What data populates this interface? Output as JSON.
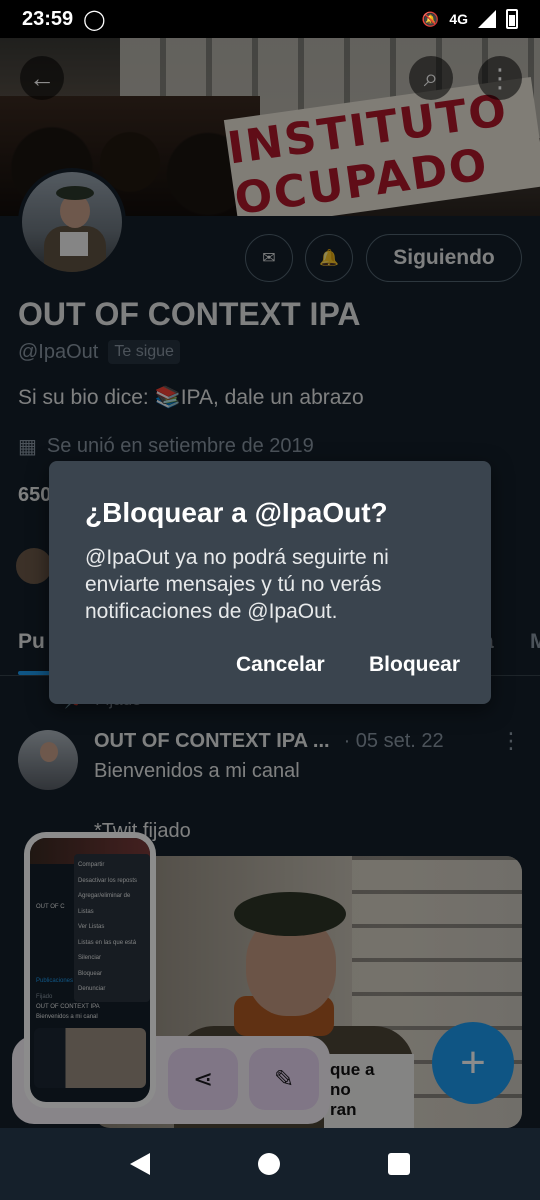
{
  "status_bar": {
    "time": "23:59",
    "network": "4G"
  },
  "banner": {
    "banner_text": "INSTITUTO OCUPADO"
  },
  "profile": {
    "name": "OUT OF CONTEXT IPA",
    "handle": "@IpaOut",
    "follows_you": "Te sigue",
    "bio": "Si su bio dice: 📚IPA, dale un abrazo",
    "joined": "Se unió en setiembre de 2019",
    "stats_prefix": "650",
    "follow_button": "Siguiendo"
  },
  "tabs": [
    {
      "label": "Pu"
    },
    {
      "label": "a"
    },
    {
      "label": "M"
    }
  ],
  "pinned_label": "Fijado",
  "tweet": {
    "name": "OUT OF CONTEXT IPA ...",
    "date": "· 05 set. 22",
    "text": "Bienvenidos a mi canal",
    "text2": "*Twit fijado",
    "image_sign": "que a\nno\nran"
  },
  "dialog": {
    "title": "¿Bloquear a @IpaOut?",
    "body": "@IpaOut ya no podrá seguirte ni enviarte mensajes y tú no verás notificaciones de @IpaOut.",
    "cancel": "Cancelar",
    "confirm": "Bloquear"
  },
  "screenshot_preview": {
    "menu_items": [
      "Compartir",
      "Desactivar los reposts",
      "Agregar/eliminar de Listas",
      "Ver Listas",
      "Listas en las que está",
      "Silenciar",
      "Bloquear",
      "Denunciar"
    ],
    "mini_name": "OUT OF C",
    "mini_tab": "Publicaciones",
    "mini_pinned": "Fijado",
    "mini_tweet": "OUT OF CONTEXT IPA",
    "mini_tweet_text": "Bienvenidos a mi canal"
  },
  "colors": {
    "accent": "#1d9bf0",
    "background": "#15202b",
    "dialog": "#3a444e"
  }
}
